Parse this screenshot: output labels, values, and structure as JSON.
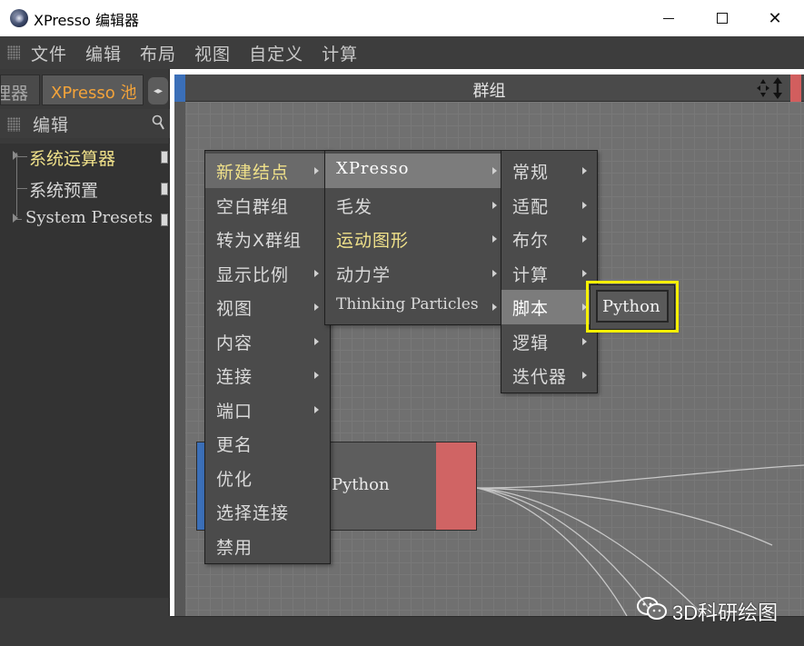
{
  "window": {
    "title": "XPresso 编辑器",
    "min_icon": "minimize-icon",
    "max_icon": "maximize-icon",
    "close_label": "✕"
  },
  "menubar": [
    "文件",
    "编辑",
    "布局",
    "视图",
    "自定义",
    "计算"
  ],
  "left_panel": {
    "tab_inactive": "理器",
    "tab_active": "XPresso 池",
    "tab_arrows": "◂▸",
    "header": "编辑",
    "tree": [
      {
        "label": "系统运算器",
        "color": "#f0e18a"
      },
      {
        "label": "系统预置",
        "color": "#d8d8d8"
      },
      {
        "label": "System Presets",
        "color": "#d8d8d8"
      }
    ]
  },
  "graph": {
    "header_title": "群组",
    "node_label": "Python"
  },
  "menu1": [
    {
      "label": "新建结点",
      "submenu": true,
      "highlight": true,
      "color": "#f0e18a"
    },
    {
      "label": "空白群组",
      "submenu": false
    },
    {
      "label": "转为X群组",
      "submenu": false
    },
    {
      "label": "显示比例",
      "submenu": true
    },
    {
      "label": "视图",
      "submenu": true
    },
    {
      "label": "内容",
      "submenu": true
    },
    {
      "label": "连接",
      "submenu": true
    },
    {
      "label": "端口",
      "submenu": true
    },
    {
      "label": "更名",
      "submenu": false
    },
    {
      "label": "优化",
      "submenu": false
    },
    {
      "label": "选择连接",
      "submenu": false
    },
    {
      "label": "禁用",
      "submenu": false
    }
  ],
  "menu2": [
    {
      "label": "XPresso",
      "submenu": true,
      "highlight": true,
      "color": "#ffffff"
    },
    {
      "label": "毛发",
      "submenu": true
    },
    {
      "label": "运动图形",
      "submenu": true,
      "color": "#f0e18a"
    },
    {
      "label": "动力学",
      "submenu": true
    },
    {
      "label": "Thinking Particles",
      "submenu": true
    }
  ],
  "menu3": [
    {
      "label": "常规",
      "submenu": true
    },
    {
      "label": "适配",
      "submenu": true
    },
    {
      "label": "布尔",
      "submenu": true
    },
    {
      "label": "计算",
      "submenu": true
    },
    {
      "label": "脚本",
      "submenu": true,
      "highlight": true,
      "color": "#ffffff"
    },
    {
      "label": "逻辑",
      "submenu": true
    },
    {
      "label": "迭代器",
      "submenu": true
    }
  ],
  "menu4": {
    "label": "Python"
  },
  "watermark": "3D科研绘图",
  "colors": {
    "accent_orange": "#f3a33a",
    "highlight_yellow": "#f6f000",
    "port_blue": "#3b6fb8",
    "port_red": "#d06464"
  }
}
